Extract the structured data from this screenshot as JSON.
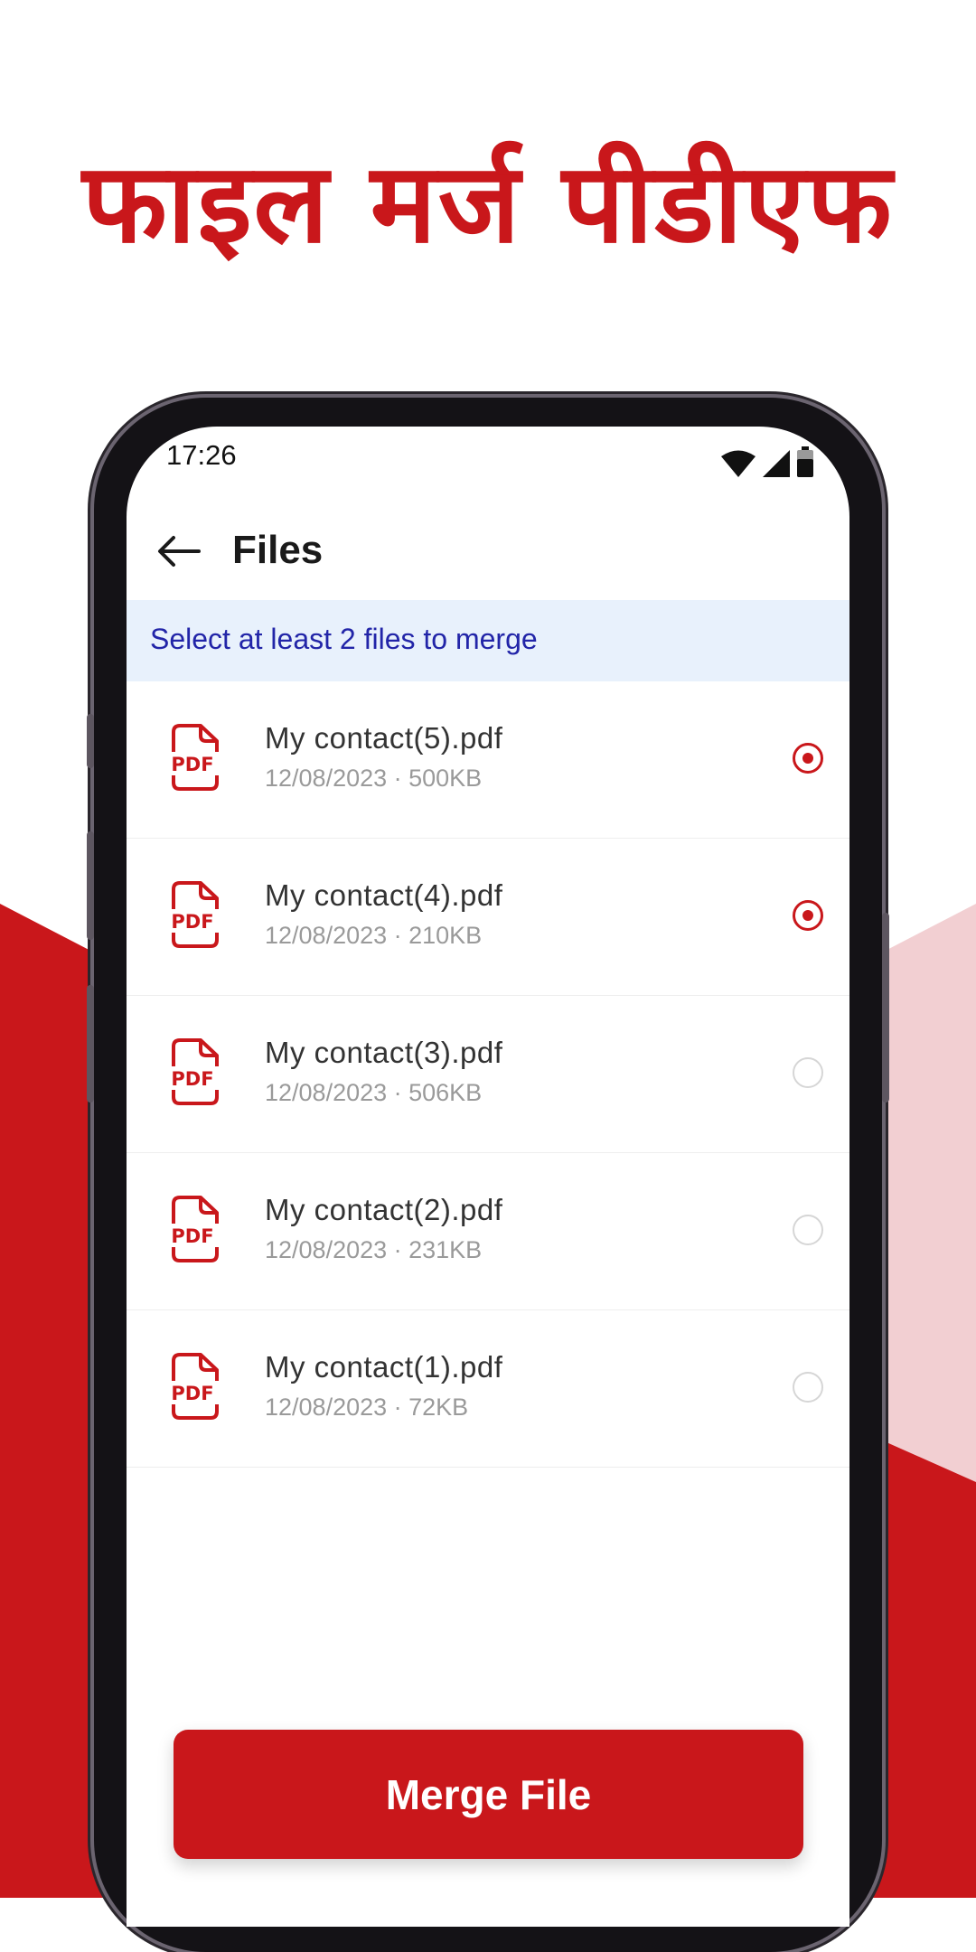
{
  "headline": "फाइल मर्ज पीडीएफ",
  "colors": {
    "accent": "#c9171b",
    "pink": "#f2cfd2",
    "hint_bg": "#e8f1fc",
    "hint_text": "#2225a8"
  },
  "status_bar": {
    "time": "17:26",
    "icons": [
      "wifi-icon",
      "signal-icon",
      "battery-icon"
    ]
  },
  "app_bar": {
    "back_icon": "arrow-left-icon",
    "title": "Files"
  },
  "hint": "Select at least 2 files to merge",
  "files": [
    {
      "name": "My contact(5).pdf",
      "meta": "12/08/2023 · 500KB",
      "selected": true
    },
    {
      "name": "My contact(4).pdf",
      "meta": "12/08/2023 · 210KB",
      "selected": true
    },
    {
      "name": "My contact(3).pdf",
      "meta": "12/08/2023 · 506KB",
      "selected": false
    },
    {
      "name": "My contact(2).pdf",
      "meta": "12/08/2023 · 231KB",
      "selected": false
    },
    {
      "name": "My contact(1).pdf",
      "meta": "12/08/2023 · 72KB",
      "selected": false
    }
  ],
  "file_icon": {
    "name": "pdf-file-icon",
    "label": "PDF"
  },
  "merge_button": "Merge File"
}
